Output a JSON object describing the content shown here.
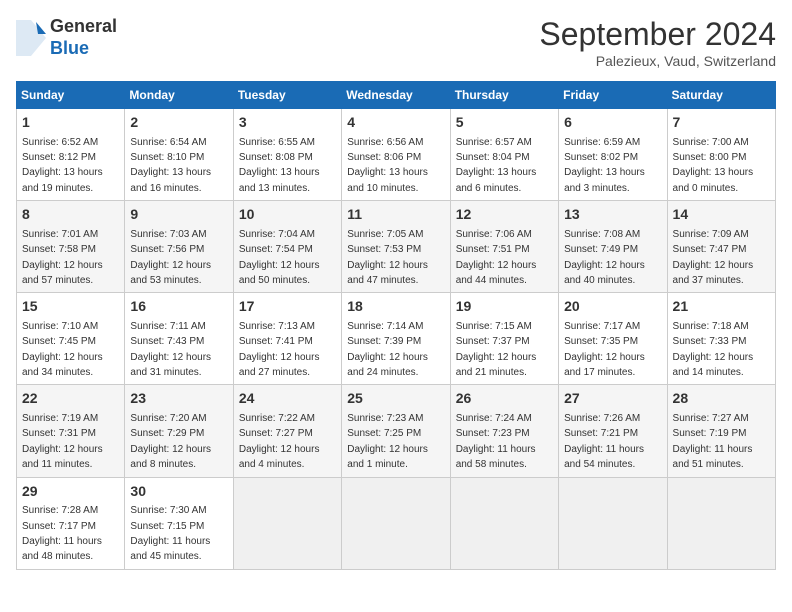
{
  "logo": {
    "line1": "General",
    "line2": "Blue"
  },
  "header": {
    "month": "September 2024",
    "location": "Palezieux, Vaud, Switzerland"
  },
  "days_of_week": [
    "Sunday",
    "Monday",
    "Tuesday",
    "Wednesday",
    "Thursday",
    "Friday",
    "Saturday"
  ],
  "weeks": [
    [
      {
        "day": "1",
        "sunrise": "6:52 AM",
        "sunset": "8:12 PM",
        "daylight": "13 hours and 19 minutes."
      },
      {
        "day": "2",
        "sunrise": "6:54 AM",
        "sunset": "8:10 PM",
        "daylight": "13 hours and 16 minutes."
      },
      {
        "day": "3",
        "sunrise": "6:55 AM",
        "sunset": "8:08 PM",
        "daylight": "13 hours and 13 minutes."
      },
      {
        "day": "4",
        "sunrise": "6:56 AM",
        "sunset": "8:06 PM",
        "daylight": "13 hours and 10 minutes."
      },
      {
        "day": "5",
        "sunrise": "6:57 AM",
        "sunset": "8:04 PM",
        "daylight": "13 hours and 6 minutes."
      },
      {
        "day": "6",
        "sunrise": "6:59 AM",
        "sunset": "8:02 PM",
        "daylight": "13 hours and 3 minutes."
      },
      {
        "day": "7",
        "sunrise": "7:00 AM",
        "sunset": "8:00 PM",
        "daylight": "13 hours and 0 minutes."
      }
    ],
    [
      {
        "day": "8",
        "sunrise": "7:01 AM",
        "sunset": "7:58 PM",
        "daylight": "12 hours and 57 minutes."
      },
      {
        "day": "9",
        "sunrise": "7:03 AM",
        "sunset": "7:56 PM",
        "daylight": "12 hours and 53 minutes."
      },
      {
        "day": "10",
        "sunrise": "7:04 AM",
        "sunset": "7:54 PM",
        "daylight": "12 hours and 50 minutes."
      },
      {
        "day": "11",
        "sunrise": "7:05 AM",
        "sunset": "7:53 PM",
        "daylight": "12 hours and 47 minutes."
      },
      {
        "day": "12",
        "sunrise": "7:06 AM",
        "sunset": "7:51 PM",
        "daylight": "12 hours and 44 minutes."
      },
      {
        "day": "13",
        "sunrise": "7:08 AM",
        "sunset": "7:49 PM",
        "daylight": "12 hours and 40 minutes."
      },
      {
        "day": "14",
        "sunrise": "7:09 AM",
        "sunset": "7:47 PM",
        "daylight": "12 hours and 37 minutes."
      }
    ],
    [
      {
        "day": "15",
        "sunrise": "7:10 AM",
        "sunset": "7:45 PM",
        "daylight": "12 hours and 34 minutes."
      },
      {
        "day": "16",
        "sunrise": "7:11 AM",
        "sunset": "7:43 PM",
        "daylight": "12 hours and 31 minutes."
      },
      {
        "day": "17",
        "sunrise": "7:13 AM",
        "sunset": "7:41 PM",
        "daylight": "12 hours and 27 minutes."
      },
      {
        "day": "18",
        "sunrise": "7:14 AM",
        "sunset": "7:39 PM",
        "daylight": "12 hours and 24 minutes."
      },
      {
        "day": "19",
        "sunrise": "7:15 AM",
        "sunset": "7:37 PM",
        "daylight": "12 hours and 21 minutes."
      },
      {
        "day": "20",
        "sunrise": "7:17 AM",
        "sunset": "7:35 PM",
        "daylight": "12 hours and 17 minutes."
      },
      {
        "day": "21",
        "sunrise": "7:18 AM",
        "sunset": "7:33 PM",
        "daylight": "12 hours and 14 minutes."
      }
    ],
    [
      {
        "day": "22",
        "sunrise": "7:19 AM",
        "sunset": "7:31 PM",
        "daylight": "12 hours and 11 minutes."
      },
      {
        "day": "23",
        "sunrise": "7:20 AM",
        "sunset": "7:29 PM",
        "daylight": "12 hours and 8 minutes."
      },
      {
        "day": "24",
        "sunrise": "7:22 AM",
        "sunset": "7:27 PM",
        "daylight": "12 hours and 4 minutes."
      },
      {
        "day": "25",
        "sunrise": "7:23 AM",
        "sunset": "7:25 PM",
        "daylight": "12 hours and 1 minute."
      },
      {
        "day": "26",
        "sunrise": "7:24 AM",
        "sunset": "7:23 PM",
        "daylight": "11 hours and 58 minutes."
      },
      {
        "day": "27",
        "sunrise": "7:26 AM",
        "sunset": "7:21 PM",
        "daylight": "11 hours and 54 minutes."
      },
      {
        "day": "28",
        "sunrise": "7:27 AM",
        "sunset": "7:19 PM",
        "daylight": "11 hours and 51 minutes."
      }
    ],
    [
      {
        "day": "29",
        "sunrise": "7:28 AM",
        "sunset": "7:17 PM",
        "daylight": "11 hours and 48 minutes."
      },
      {
        "day": "30",
        "sunrise": "7:30 AM",
        "sunset": "7:15 PM",
        "daylight": "11 hours and 45 minutes."
      },
      null,
      null,
      null,
      null,
      null
    ]
  ],
  "labels": {
    "sunrise": "Sunrise:",
    "sunset": "Sunset:",
    "daylight": "Daylight hours"
  }
}
